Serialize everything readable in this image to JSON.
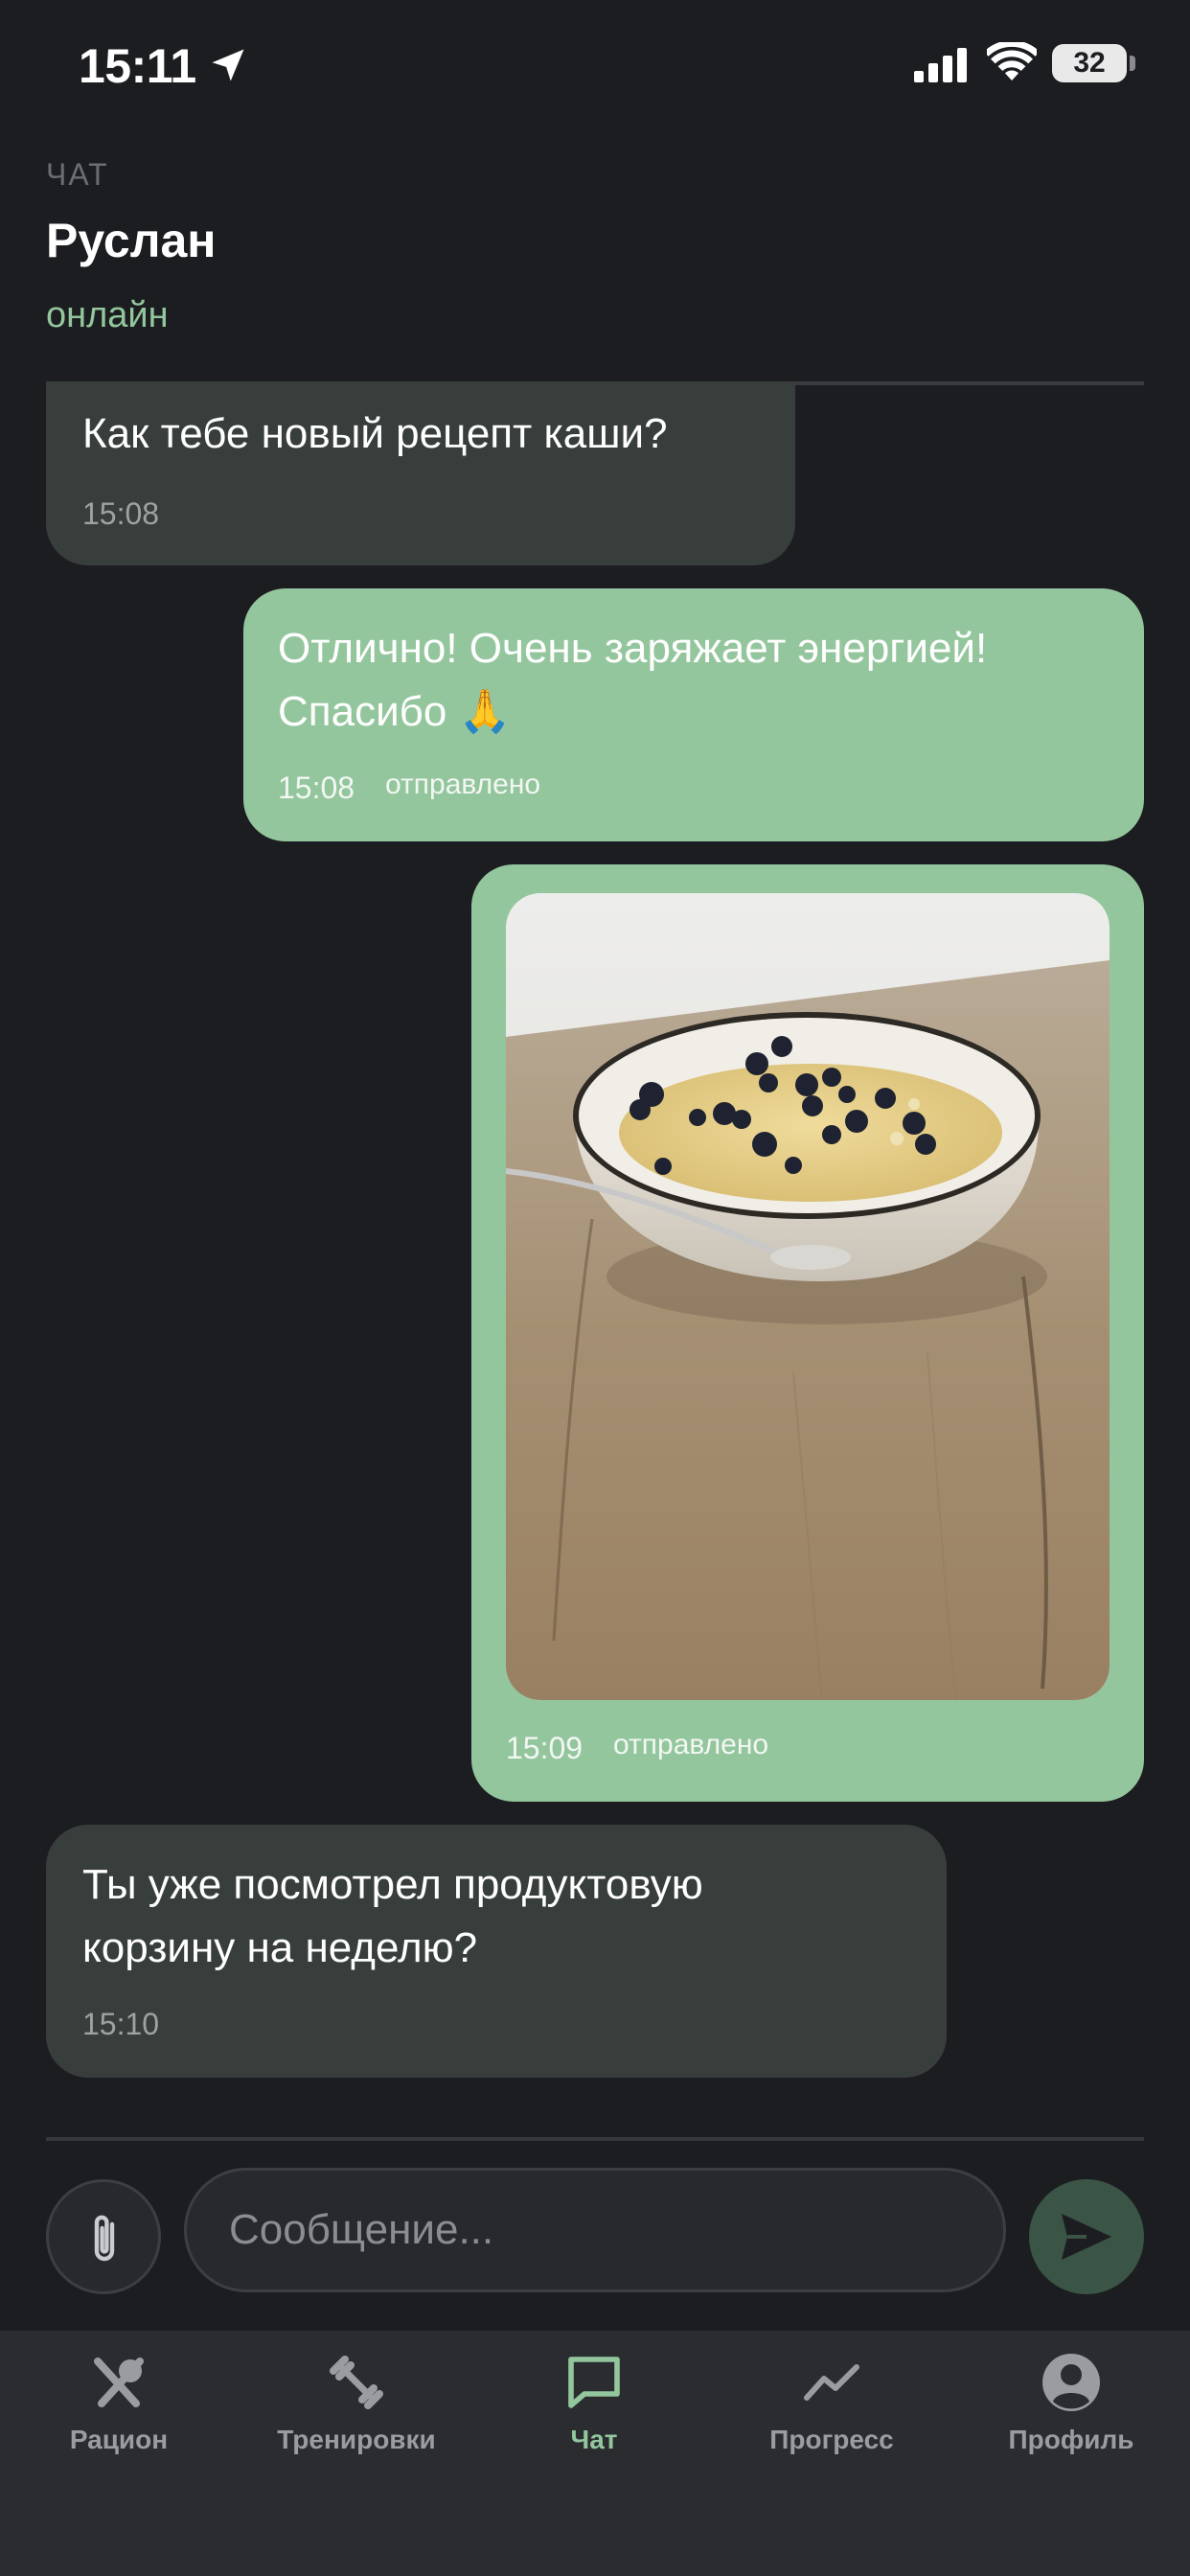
{
  "status_bar": {
    "time": "15:11",
    "battery": "32"
  },
  "header": {
    "caption": "ЧАТ",
    "name": "Руслан",
    "status": "онлайн"
  },
  "messages": [
    {
      "direction": "in",
      "text": "Как тебе новый рецепт каши?",
      "time": "15:08"
    },
    {
      "direction": "out",
      "text_line1": "Отлично! Очень заряжает энергией!",
      "text_line2": "Спасибо 🙏",
      "time": "15:08",
      "state": "отправлено"
    },
    {
      "direction": "out",
      "type": "image",
      "time": "15:09",
      "state": "отправлено"
    },
    {
      "direction": "in",
      "text_line1": "Ты уже посмотрел продуктовую",
      "text_line2": "корзину на неделю?",
      "time": "15:10"
    }
  ],
  "composer": {
    "placeholder": "Сообщение..."
  },
  "tabs": [
    {
      "label": "Рацион",
      "icon": "utensils-icon"
    },
    {
      "label": "Тренировки",
      "icon": "dumbbell-icon"
    },
    {
      "label": "Чат",
      "icon": "chat-icon",
      "active": true
    },
    {
      "label": "Прогресс",
      "icon": "trend-icon"
    },
    {
      "label": "Профиль",
      "icon": "profile-icon"
    }
  ],
  "colors": {
    "background": "#1c1d20",
    "accent": "#93c69d",
    "incoming_bubble": "#373e3c",
    "outgoing_bubble": "#94c69d",
    "tab_bar": "#2b2c30"
  }
}
